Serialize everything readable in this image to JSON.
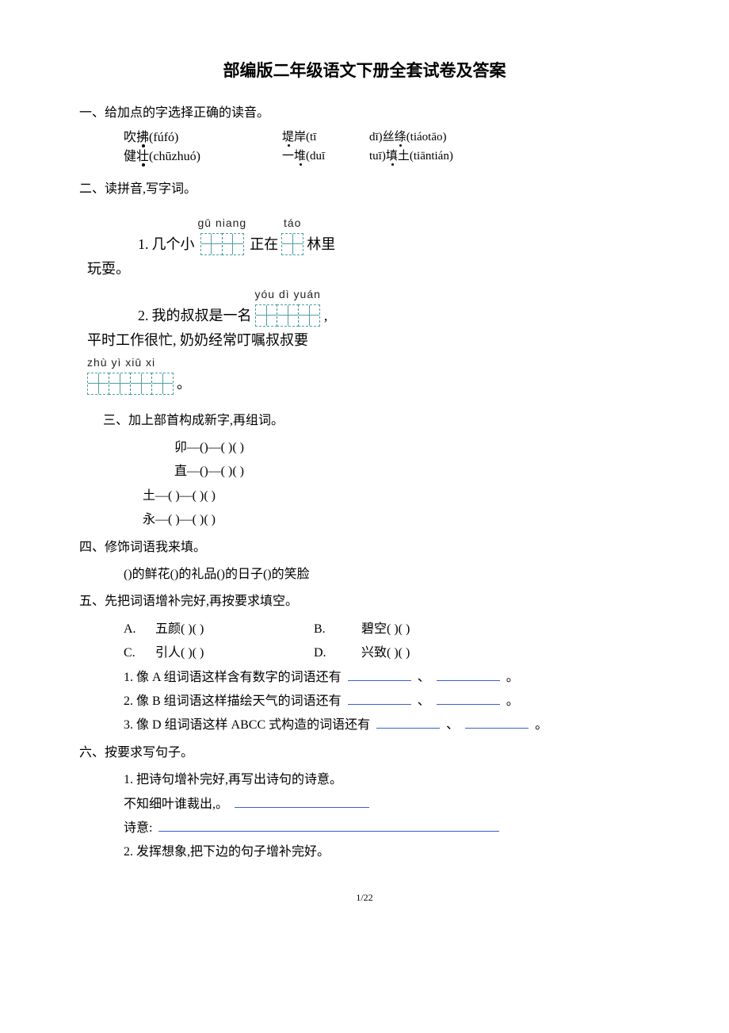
{
  "title": "部编版二年级语文下册全套试卷及答案",
  "q1": {
    "heading": "一、给加点的字选择正确的读音。",
    "r1c1": "吹拂(fúfó)",
    "r1c2a": "堤岸(tī",
    "r1c2b": "一堆(duī",
    "r1c3a": "dī)丝绦(tiáotāo)",
    "r1c3b": "tuī)填土(tiāntián)",
    "r2c1": "健壮(chūzhuó)"
  },
  "q2": {
    "heading": "二、读拼音,写字词。",
    "line1_num": "1.",
    "line1_pre": "几个小",
    "line1_py1": "gū niang",
    "line1_mid": "正在",
    "line1_py2": "táo",
    "line1_post": "林里",
    "line1b": "玩耍。",
    "line2_num": "2.",
    "line2_pre": "我的叔叔是一名",
    "line2_py": "yóu  dì  yuán",
    "line2_tail": ",",
    "line2b": "平时工作很忙, 奶奶经常叮嘱叔叔要",
    "line2c_py": "zhù  yì  xiū  xi",
    "line2c_tail": "。"
  },
  "q3": {
    "heading": "三、加上部首构成新字,再组词。",
    "r1": "卯—()—(        )(          )",
    "r2": "直—()—(        )(          )",
    "r3": "土—(          )—(        )(          )",
    "r4": "永—(          )—(        )(          )"
  },
  "q4": {
    "heading": "四、修饰词语我来填。",
    "line": "()的鲜花()的礼品()的日子()的笑脸"
  },
  "q5": {
    "heading": "五、先把词语增补完好,再按要求填空。",
    "A_label": "A.",
    "A_text": "五颜(        )(       )",
    "B_label": "B.",
    "B_text": "碧空(        )(       )",
    "C_label": "C.",
    "C_text": "引人(        )(       )",
    "D_label": "D.",
    "D_text": "兴致(        )(       )",
    "line1a": "1.  像 A 组词语这样含有数字的词语还有",
    "line1b": "、",
    "line1c": "。",
    "line2a": "2.  像 B 组词语这样描绘天气的词语还有",
    "line2b": "、",
    "line2c": "。",
    "line3a": "3. 像 D 组词语这样 ABCC 式构造的词语还有",
    "line3b": "、",
    "line3c": "。"
  },
  "q6": {
    "heading": "六、按要求写句子。",
    "s1": "1. 把诗句增补完好,再写出诗句的诗意。",
    "s1a": "不知细叶谁裁出,。",
    "s1b": "诗意:",
    "s2": "2. 发挥想象,把下边的句子增补完好。"
  },
  "footer": "1/22"
}
